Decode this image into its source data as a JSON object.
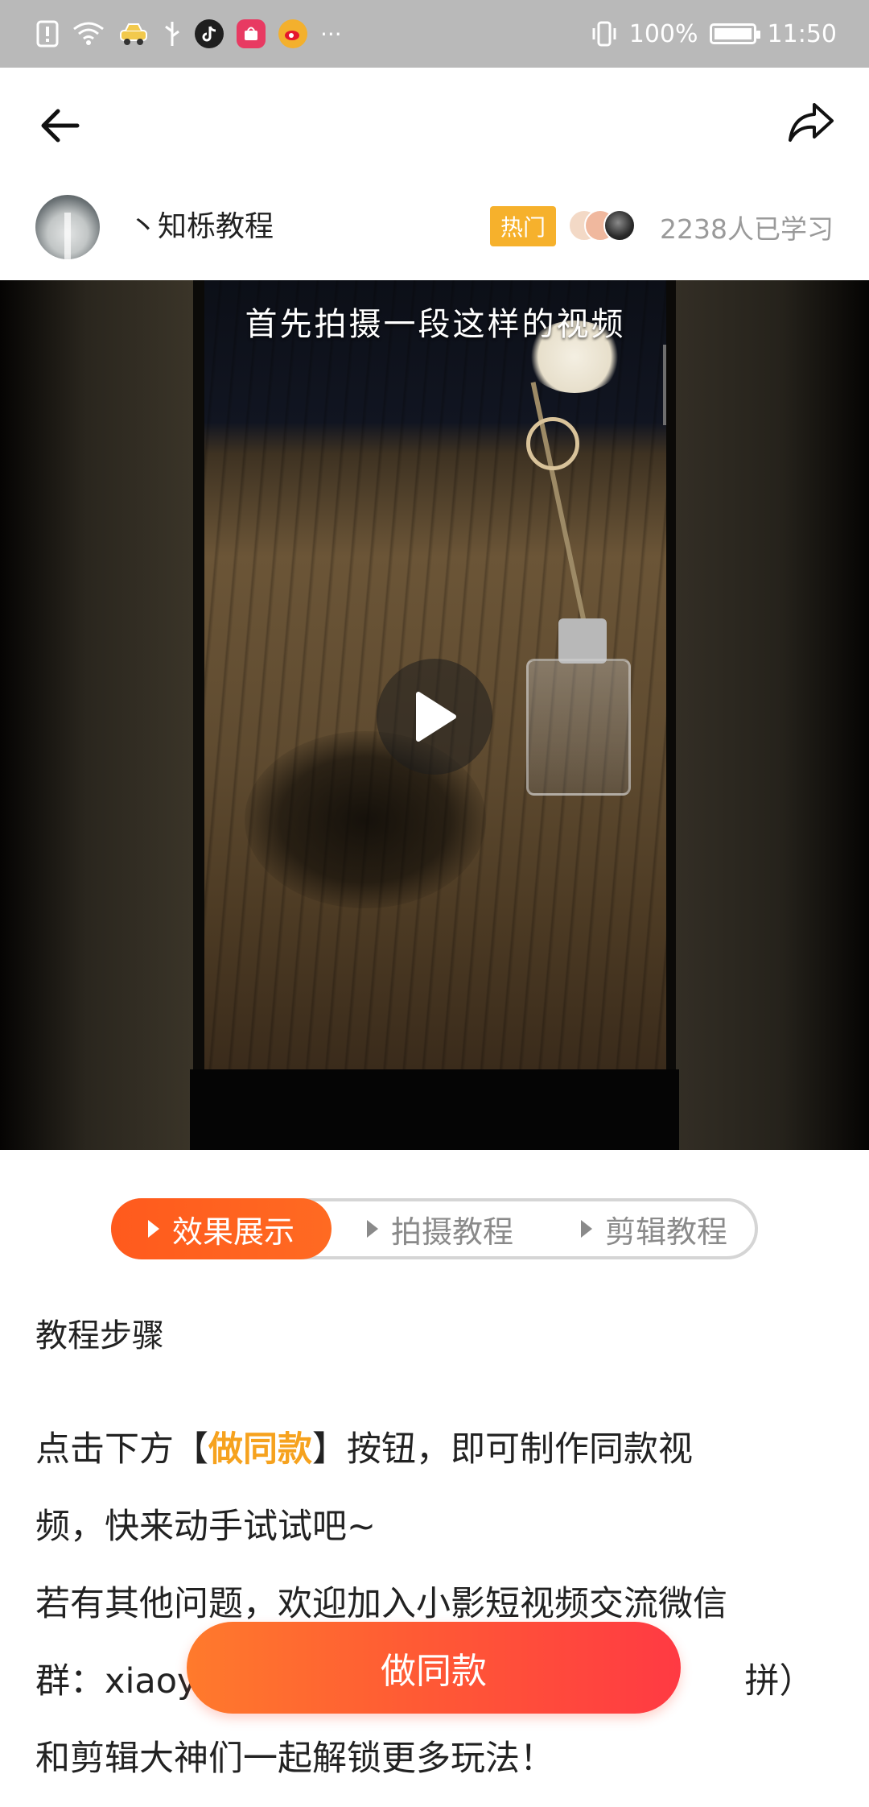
{
  "status_bar": {
    "battery_percent": "100%",
    "time": "11:50",
    "battery_level": 1.0
  },
  "author": {
    "name": "丶知栎教程",
    "badge": "热门",
    "learned_count": "2238人已学习"
  },
  "video": {
    "caption": "首先拍摄一段这样的视频"
  },
  "tabs": [
    {
      "label": "效果展示",
      "active": true
    },
    {
      "label": "拍摄教程",
      "active": false
    },
    {
      "label": "剪辑教程",
      "active": false
    }
  ],
  "content": {
    "section_title": "教程步骤",
    "line1_prefix": "点击下方【",
    "line1_highlight": "做同款",
    "line1_suffix": "】按钮，即可制作同款视",
    "line2": "频，快来动手试试吧~",
    "line3": "若有其他问题，欢迎加入小影短视频交流微信",
    "line4_left": "群：xiaoy",
    "line4_right": "拼）",
    "line5": "和剪辑大神们一起解锁更多玩法！"
  },
  "cta": {
    "label": "做同款"
  },
  "colors": {
    "accent_orange": "#ff5a1d",
    "highlight_gold": "#f6a21e",
    "hot_badge": "#f6b12c",
    "cta_red": "#ff3a43"
  },
  "icons": [
    "back-arrow-icon",
    "share-icon",
    "play-icon",
    "tab-play-icon"
  ]
}
